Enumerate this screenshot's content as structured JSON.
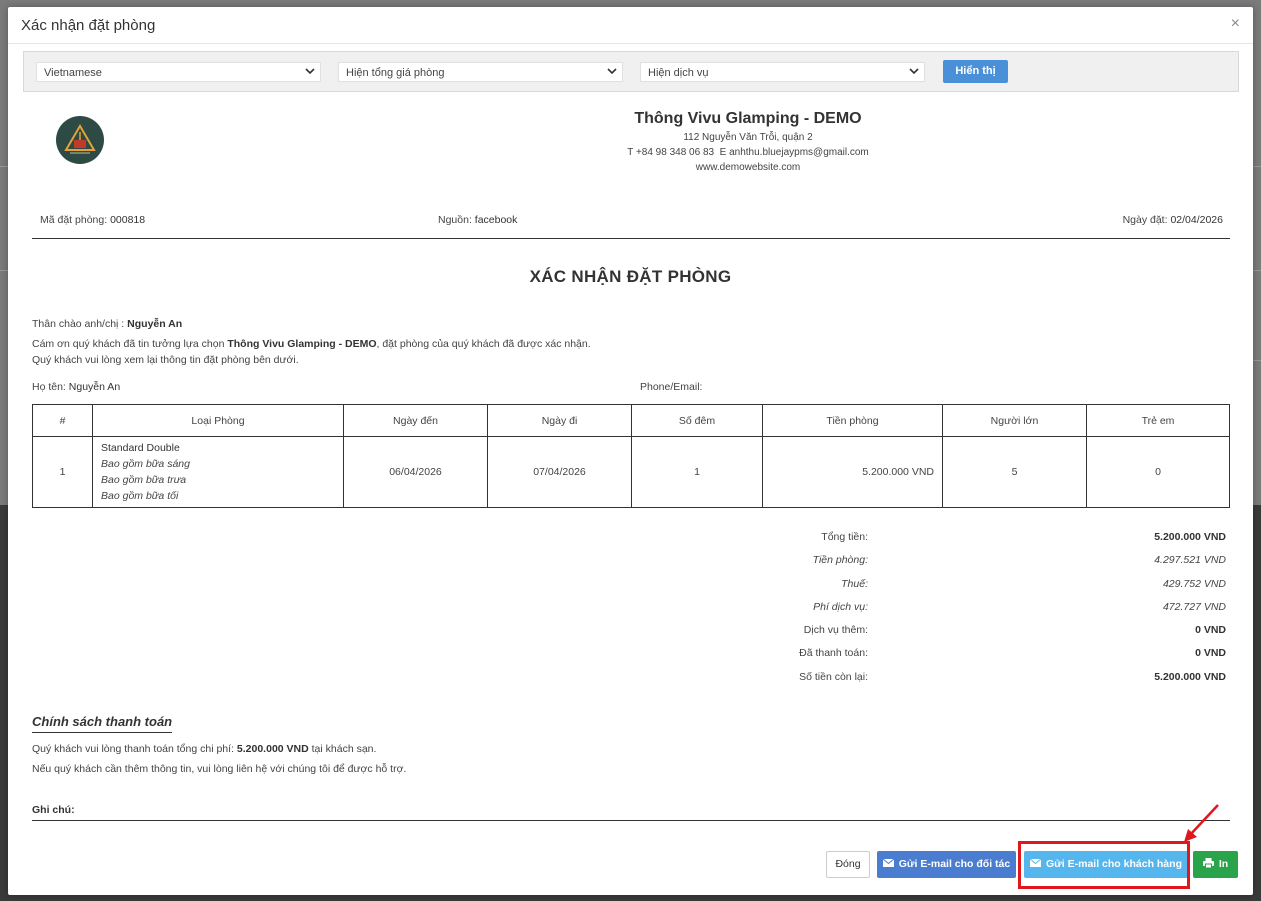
{
  "modal": {
    "title": "Xác nhận đặt phòng",
    "close_glyph": "×"
  },
  "filters": {
    "language": "Vietnamese",
    "price_display": "Hiện tổng giá phòng",
    "service_display": "Hiện dịch vụ",
    "show_label": "Hiển thị"
  },
  "hotel": {
    "name": "Thông Vivu Glamping - DEMO",
    "address": "112 Nguyễn Văn Trỗi, quận 2",
    "phone_prefix": "T",
    "phone": "+84 98 348 06 83",
    "email_prefix": "E",
    "email": "anhthu.bluejaypms@gmail.com",
    "website": "www.demowebsite.com"
  },
  "meta": {
    "booking_code_label": "Mã đặt phòng:",
    "booking_code": "000818",
    "source_label": "Nguồn:",
    "source": "facebook",
    "booking_date_label": "Ngày đặt:",
    "booking_date": "02/04/2026"
  },
  "doc_title": "XÁC NHẬN ĐẶT PHÒNG",
  "greeting": {
    "prefix": "Thân chào anh/chị :",
    "name": "Nguyễn An"
  },
  "thanks": {
    "before": "Cám ơn quý khách đã tin tưởng lựa chọn",
    "hotel": "Thông Vivu Glamping - DEMO",
    "after": ", đặt phòng của quý khách đã được xác nhận."
  },
  "review_note": "Quý khách vui lòng xem lại thông tin đặt phòng bên dưới.",
  "guest": {
    "name_label": "Họ tên:",
    "name": "Nguyễn An",
    "contact_label": "Phone/Email:",
    "contact": ""
  },
  "table": {
    "headers": [
      "#",
      "Loại Phòng",
      "Ngày đến",
      "Ngày đi",
      "Số đêm",
      "Tiền phòng",
      "Người lớn",
      "Trẻ em"
    ],
    "rows": [
      {
        "index": "1",
        "room": "Standard Double",
        "inclusions": [
          "Bao gồm bữa sáng",
          "Bao gồm bữa trưa",
          "Bao gồm bữa tối"
        ],
        "arrival": "06/04/2026",
        "departure": "07/04/2026",
        "nights": "1",
        "price": "5.200.000 VND",
        "adults": "5",
        "children": "0"
      }
    ]
  },
  "totals": [
    {
      "label": "Tổng tiền:",
      "value": "5.200.000 VND"
    },
    {
      "label": "Tiền phòng:",
      "value": "4.297.521 VND"
    },
    {
      "label": "Thuế:",
      "value": "429.752 VND"
    },
    {
      "label": "Phí dịch vụ:",
      "value": "472.727 VND"
    },
    {
      "label": "Dịch vụ thêm:",
      "value": "0 VND"
    },
    {
      "label": "Đã thanh toán:",
      "value": "0 VND"
    },
    {
      "label": "Số tiền còn lại:",
      "value": "5.200.000 VND"
    }
  ],
  "policy": {
    "title": "Chính sách thanh toán",
    "line1_before": "Quý khách vui lòng thanh toán tổng chi phí:",
    "line1_amount": "5.200.000 VND",
    "line1_after": "tại khách sạn.",
    "line2": "Nếu quý khách cần thêm thông tin, vui lòng liên hệ với chúng tôi để được hỗ trợ."
  },
  "note_label": "Ghi chú:",
  "footer": {
    "close_label": "Đóng",
    "email_partner_label": "Gửi E-mail cho đối tác",
    "email_guest_label": "Gửi E-mail cho khách hàng",
    "print_label": "In"
  },
  "colors": {
    "primary": "#4a7ccf",
    "info": "#55b6ee",
    "success": "#2aa44a",
    "highlight": "#e0181d"
  },
  "icons": [
    "close-icon",
    "chevron-down-icon",
    "hotel-logo",
    "envelope-icon",
    "print-icon",
    "red-arrow-annotation"
  ]
}
